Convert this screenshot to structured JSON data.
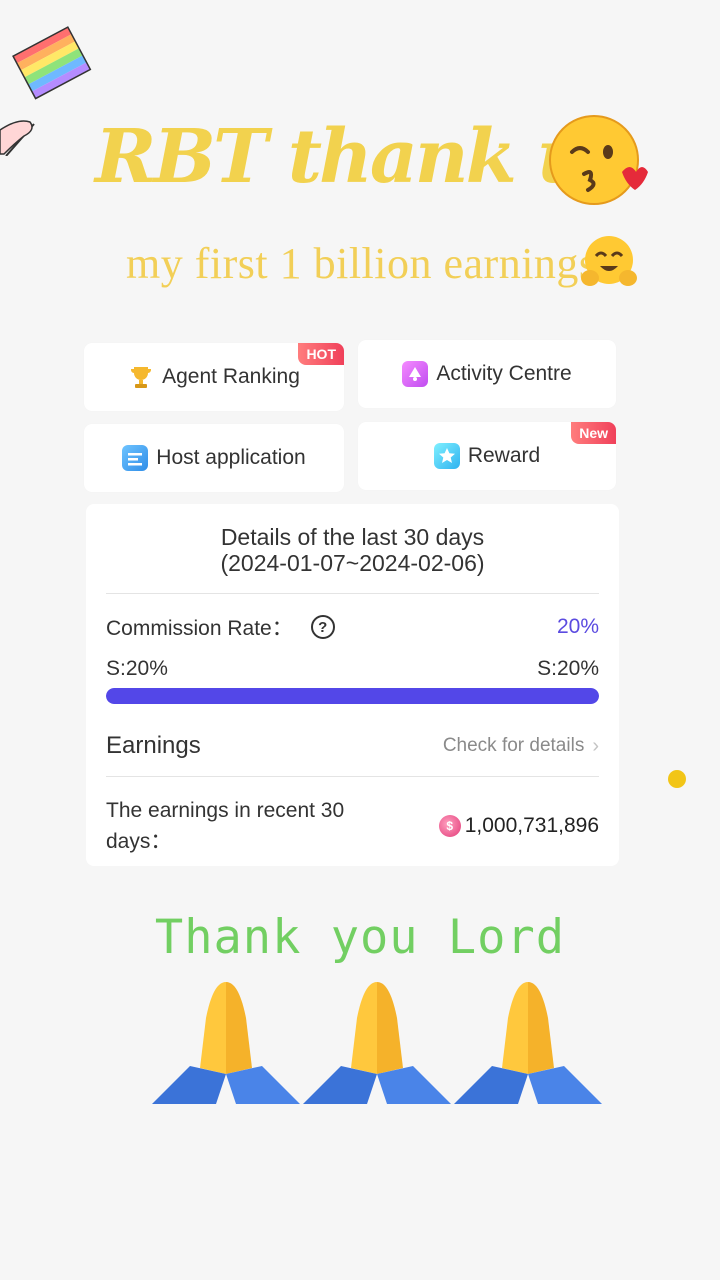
{
  "overlay": {
    "title": "RBT thank u",
    "subtitle": "my first 1 billion earnings",
    "thanks": "Thank you Lord"
  },
  "tiles": [
    {
      "label": "Agent Ranking",
      "icon": "trophy-icon",
      "badge": "HOT"
    },
    {
      "label": "Activity Centre",
      "icon": "activity-icon",
      "badge": ""
    },
    {
      "label": "Host application",
      "icon": "document-icon",
      "badge": ""
    },
    {
      "label": "Reward",
      "icon": "star-icon",
      "badge": "New"
    }
  ],
  "details": {
    "heading": "Details of the last 30 days",
    "range": "(2024-01-07~2024-02-06)",
    "commission_label": "Commission Rate：",
    "commission_value": "20%",
    "start_level": "S:20%",
    "end_level": "S:20%",
    "progress": 1.0,
    "earnings_title": "Earnings",
    "check_link": "Check for details",
    "recent_label": "The earnings in recent 30 days：",
    "recent_value": "1,000,731,896"
  },
  "colors": {
    "title": "#f2d24e",
    "thanks": "#72cf62",
    "accent": "#5347e8",
    "badge": "#f0405a"
  }
}
